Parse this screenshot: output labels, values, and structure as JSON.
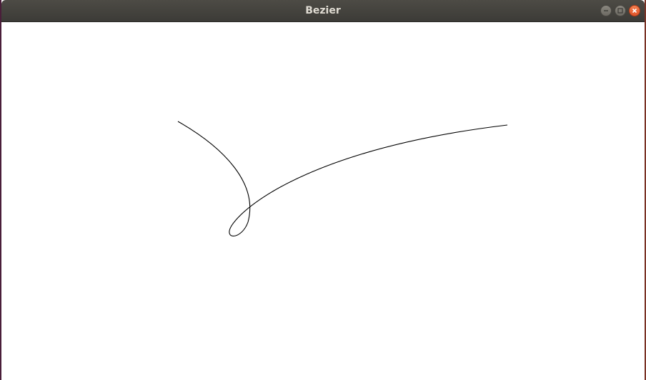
{
  "window": {
    "title": "Bezier",
    "controls": [
      {
        "name": "minimize",
        "icon": "minimize-icon"
      },
      {
        "name": "maximize",
        "icon": "maximize-icon"
      },
      {
        "name": "close",
        "icon": "close-icon"
      }
    ]
  },
  "canvas": {
    "background": "#ffffff",
    "stroke_color": "#000000"
  },
  "colors": {
    "titlebar": "#3c3b37",
    "title_text": "#dfdbd2",
    "close_button": "#e95420"
  }
}
